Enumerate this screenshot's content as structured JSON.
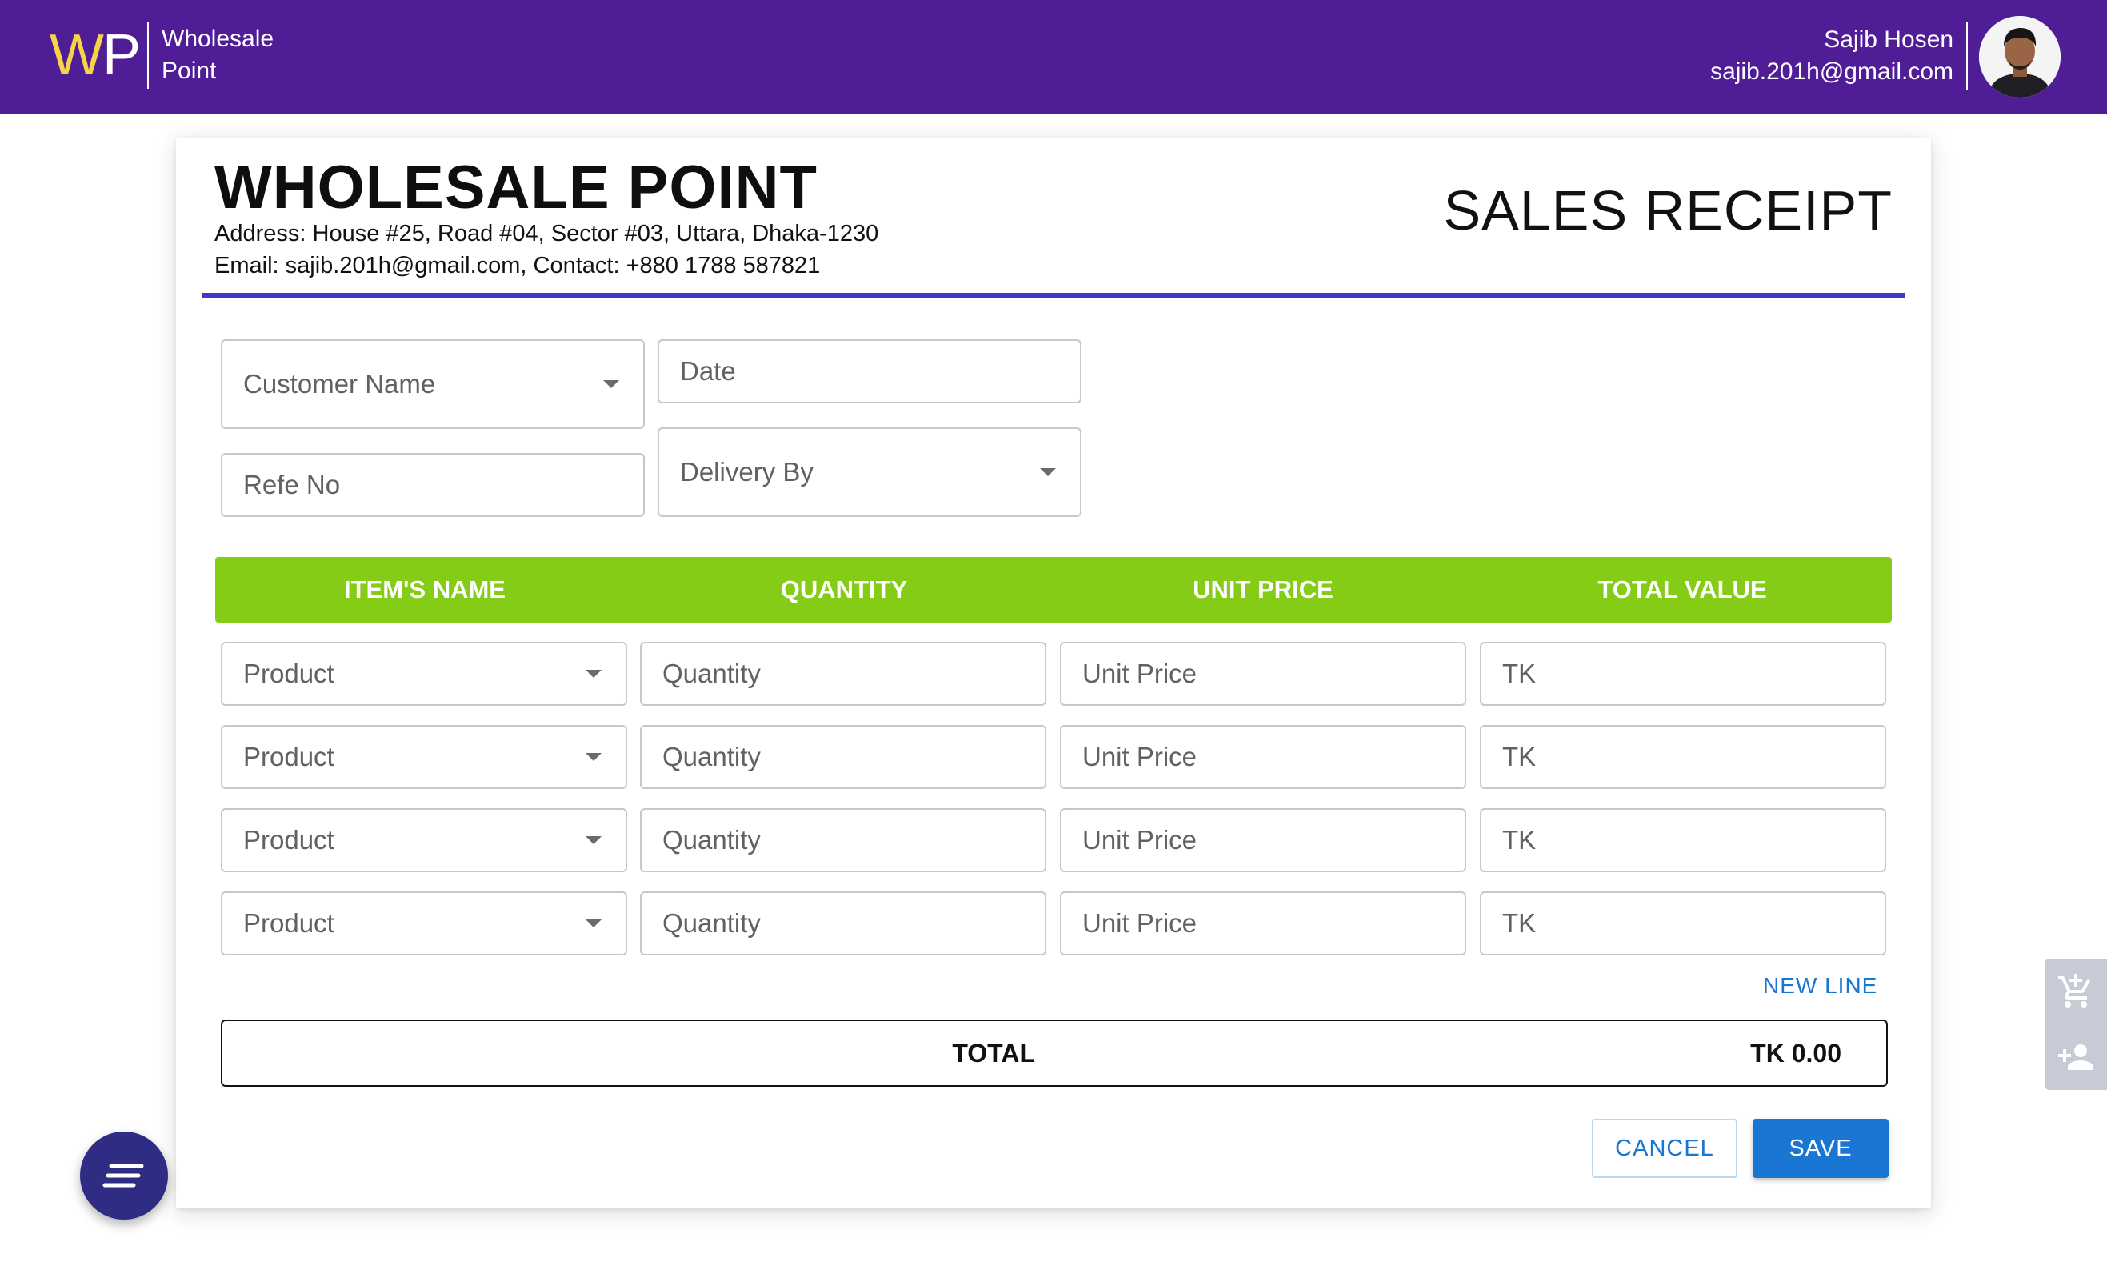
{
  "header": {
    "logo_letters_w": "W",
    "logo_letters_p": "P",
    "logo_line1": "Wholesale",
    "logo_line2": "Point",
    "user_name": "Sajib Hosen",
    "user_email": "sajib.201h@gmail.com"
  },
  "company": {
    "name": "WHOLESALE POINT",
    "address": "Address: House #25, Road #04, Sector #03, Uttara, Dhaka-1230",
    "contact": "Email: sajib.201h@gmail.com, Contact: +880 1788 587821"
  },
  "receipt_title": "SALES RECEIPT",
  "form": {
    "customer_name": "Customer Name",
    "date": "Date",
    "refe_no": "Refe No",
    "delivery_by": "Delivery By"
  },
  "table": {
    "columns": [
      "ITEM'S NAME",
      "QUANTITY",
      "UNIT PRICE",
      "TOTAL VALUE"
    ],
    "rows": [
      {
        "product": "Product",
        "quantity": "Quantity",
        "unit_price": "Unit Price",
        "total": "TK"
      },
      {
        "product": "Product",
        "quantity": "Quantity",
        "unit_price": "Unit Price",
        "total": "TK"
      },
      {
        "product": "Product",
        "quantity": "Quantity",
        "unit_price": "Unit Price",
        "total": "TK"
      },
      {
        "product": "Product",
        "quantity": "Quantity",
        "unit_price": "Unit Price",
        "total": "TK"
      }
    ]
  },
  "new_line": "NEW LINE",
  "total": {
    "label": "TOTAL",
    "value": "TK 0.00"
  },
  "buttons": {
    "cancel": "CANCEL",
    "save": "SAVE"
  },
  "icons": {
    "fab": "menu-lines-icon",
    "side_top": "add-cart-icon",
    "side_bottom": "add-person-icon"
  },
  "colors": {
    "topbar": "#4f1d96",
    "logo_w": "#f7d34a",
    "table_header": "#84cc16",
    "rule": "#3e3ac9",
    "primary": "#1976d2"
  }
}
